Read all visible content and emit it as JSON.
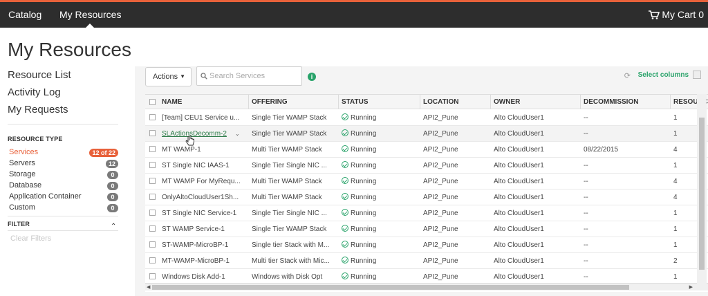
{
  "topbar": {
    "catalog_label": "Catalog",
    "my_resources_label": "My Resources",
    "cart_label": "My Cart",
    "cart_count": "0"
  },
  "page": {
    "title": "My Resources"
  },
  "sidebar": {
    "links": [
      {
        "label": "Resource List"
      },
      {
        "label": "Activity Log"
      },
      {
        "label": "My Requests"
      }
    ],
    "resource_type_header": "RESOURCE TYPE",
    "resource_types": [
      {
        "label": "Services",
        "count": "12 of 22",
        "active": true
      },
      {
        "label": "Servers",
        "count": "12",
        "active": false
      },
      {
        "label": "Storage",
        "count": "0",
        "active": false
      },
      {
        "label": "Database",
        "count": "0",
        "active": false
      },
      {
        "label": "Application Container",
        "count": "0",
        "active": false
      },
      {
        "label": "Custom",
        "count": "0",
        "active": false
      }
    ],
    "filter_header": "FILTER",
    "clear_filters_label": "Clear Filters"
  },
  "toolbar": {
    "actions_label": "Actions",
    "search_placeholder": "Search Services",
    "select_columns_label": "Select columns"
  },
  "table": {
    "columns": [
      "NAME",
      "OFFERING",
      "STATUS",
      "LOCATION",
      "OWNER",
      "DECOMMISSION",
      "RESOURC"
    ],
    "rows": [
      {
        "name": "[Team] CEU1 Service u...",
        "offering": "Single Tier WAMP Stack",
        "status": "Running",
        "location": "API2_Pune",
        "owner": "Alto CloudUser1",
        "decommission": "--",
        "resources": "1"
      },
      {
        "name": "SLActionsDecomm-2",
        "offering": "Single Tier WAMP Stack",
        "status": "Running",
        "location": "API2_Pune",
        "owner": "Alto CloudUser1",
        "decommission": "--",
        "resources": "1"
      },
      {
        "name": "MT WAMP-1",
        "offering": "Multi Tier WAMP Stack",
        "status": "Running",
        "location": "API2_Pune",
        "owner": "Alto CloudUser1",
        "decommission": "08/22/2015",
        "resources": "4"
      },
      {
        "name": "ST Single NIC IAAS-1",
        "offering": "Single Tier Single NIC ...",
        "status": "Running",
        "location": "API2_Pune",
        "owner": "Alto CloudUser1",
        "decommission": "--",
        "resources": "1"
      },
      {
        "name": "MT WAMP For MyRequ...",
        "offering": "Multi Tier WAMP Stack",
        "status": "Running",
        "location": "API2_Pune",
        "owner": "Alto CloudUser1",
        "decommission": "--",
        "resources": "4"
      },
      {
        "name": "OnlyAltoCloudUser1Sh...",
        "offering": "Multi Tier WAMP Stack",
        "status": "Running",
        "location": "API2_Pune",
        "owner": "Alto CloudUser1",
        "decommission": "--",
        "resources": "4"
      },
      {
        "name": "ST Single NIC Service-1",
        "offering": "Single Tier Single NIC ...",
        "status": "Running",
        "location": "API2_Pune",
        "owner": "Alto CloudUser1",
        "decommission": "--",
        "resources": "1"
      },
      {
        "name": "ST WAMP Service-1",
        "offering": "Single Tier WAMP Stack",
        "status": "Running",
        "location": "API2_Pune",
        "owner": "Alto CloudUser1",
        "decommission": "--",
        "resources": "1"
      },
      {
        "name": "ST-WAMP-MicroBP-1",
        "offering": "Single tier Stack with M...",
        "status": "Running",
        "location": "API2_Pune",
        "owner": "Alto CloudUser1",
        "decommission": "--",
        "resources": "1"
      },
      {
        "name": "MT-WAMP-MicroBP-1",
        "offering": "Multi tier Stack with Mic...",
        "status": "Running",
        "location": "API2_Pune",
        "owner": "Alto CloudUser1",
        "decommission": "--",
        "resources": "2"
      },
      {
        "name": "Windows Disk Add-1",
        "offering": "Windows with Disk Opt",
        "status": "Running",
        "location": "API2_Pune",
        "owner": "Alto CloudUser1",
        "decommission": "--",
        "resources": "1"
      }
    ]
  },
  "colors": {
    "accent": "#e8613a",
    "topbar": "#2d2d2d",
    "success": "#29a36a",
    "link": "#2a7a46"
  }
}
